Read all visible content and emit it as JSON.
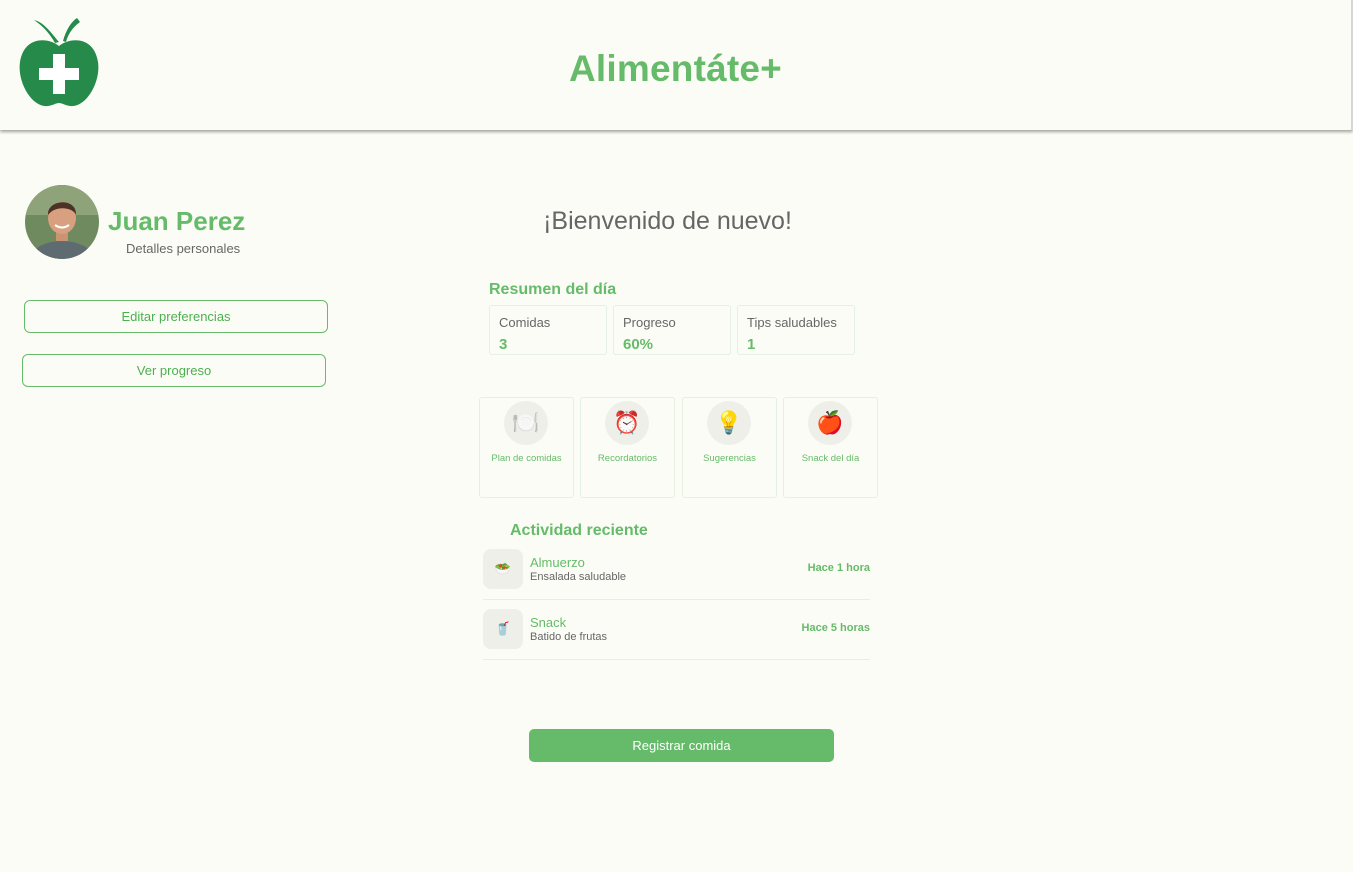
{
  "header": {
    "app_title": "Alimentáte+"
  },
  "colors": {
    "accent": "#66bb6a",
    "logo": "#268a4a",
    "background": "#fcfcf6"
  },
  "profile": {
    "name": "Juan Perez",
    "subtitle": "Detalles personales",
    "buttons": {
      "edit_preferences": "Editar preferencias",
      "view_progress": "Ver progreso"
    }
  },
  "main": {
    "welcome": "¡Bienvenido de nuevo!",
    "summary": {
      "title": "Resumen del día",
      "stats": [
        {
          "label": "Comidas",
          "value": "3"
        },
        {
          "label": "Progreso",
          "value": "60%"
        },
        {
          "label": "Tips saludables",
          "value": "1"
        }
      ]
    },
    "features": [
      {
        "label": "Plan de comidas",
        "icon": "plate-cutlery-icon",
        "glyph": "🍽️"
      },
      {
        "label": "Recordatorios",
        "icon": "alarm-clock-icon",
        "glyph": "⏰"
      },
      {
        "label": "Sugerencias",
        "icon": "lightbulb-icon",
        "glyph": "💡"
      },
      {
        "label": "Snack del día",
        "icon": "apple-icon",
        "glyph": "🍎"
      }
    ],
    "activity": {
      "title": "Actividad reciente",
      "items": [
        {
          "title": "Almuerzo",
          "desc": "Ensalada saludable",
          "time": "Hace 1 hora",
          "icon": "salad-bowl-icon",
          "glyph": "🥗"
        },
        {
          "title": "Snack",
          "desc": "Batido de frutas",
          "time": "Hace 5 horas",
          "icon": "smoothie-cup-icon",
          "glyph": "🥤"
        }
      ]
    },
    "register_button": "Registrar comida"
  }
}
